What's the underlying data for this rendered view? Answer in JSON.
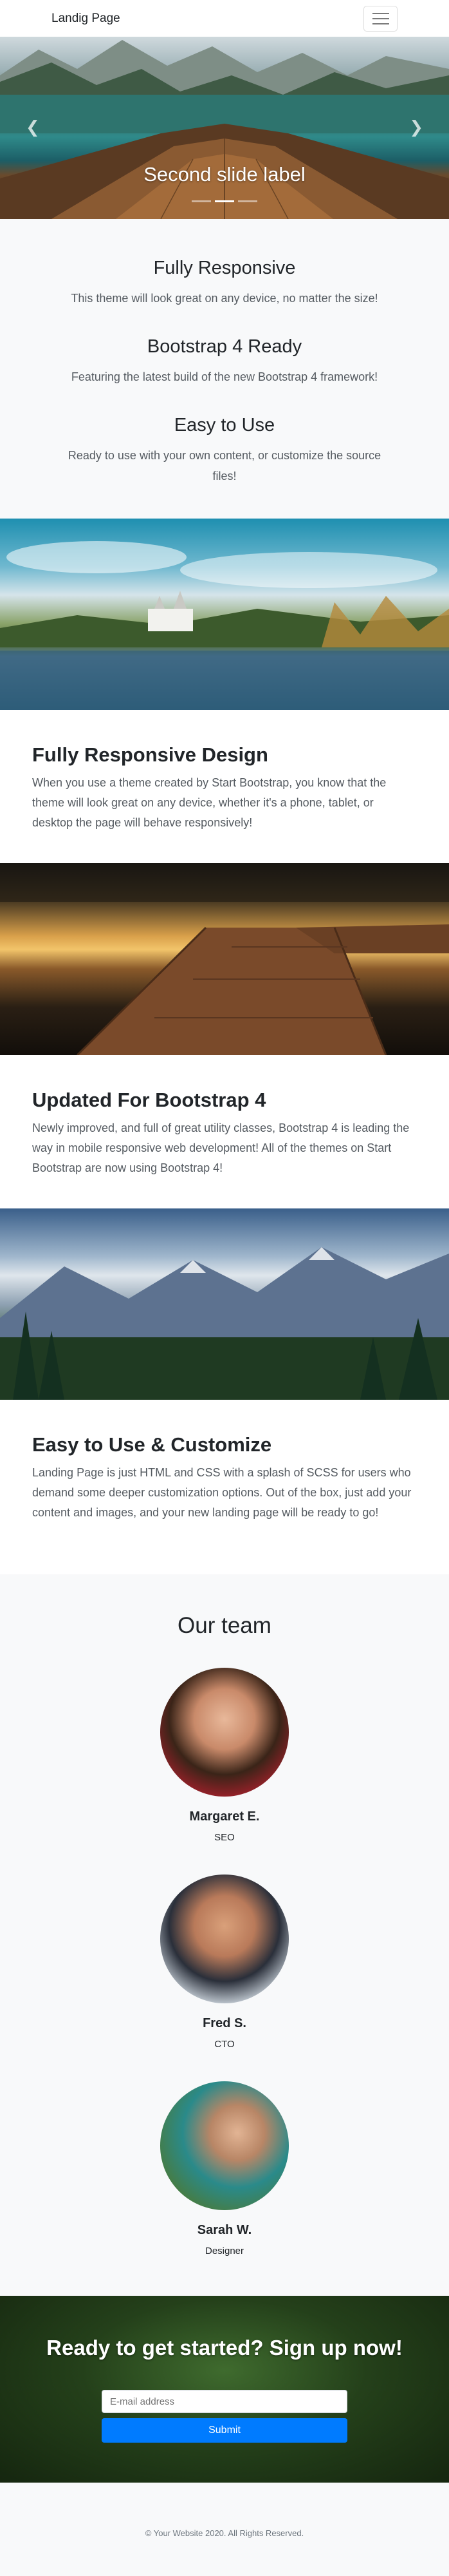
{
  "navbar": {
    "brand": "Landig Page",
    "toggle_icon": "hamburger-icon"
  },
  "carousel": {
    "caption": "Second slide label",
    "prev_icon": "chevron-left-icon",
    "next_icon": "chevron-right-icon",
    "slide_count": 3,
    "active_slide": 2
  },
  "features": [
    {
      "title": "Fully Responsive",
      "text": "This theme will look great on any device, no matter the size!"
    },
    {
      "title": "Bootstrap 4 Ready",
      "text": "Featuring the latest build of the new Bootstrap 4 framework!"
    },
    {
      "title": "Easy to Use",
      "text": "Ready to use with your own content, or customize the source files!"
    }
  ],
  "sections": [
    {
      "title": "Fully Responsive Design",
      "text": "When you use a theme created by Start Bootstrap, you know that the theme will look great on any device, whether it's a phone, tablet, or desktop the page will behave responsively!"
    },
    {
      "title": "Updated For Bootstrap 4",
      "text": "Newly improved, and full of great utility classes, Bootstrap 4 is leading the way in mobile responsive web development! All of the themes on Start Bootstrap are now using Bootstrap 4!"
    },
    {
      "title": "Easy to Use & Customize",
      "text": "Landing Page is just HTML and CSS with a splash of SCSS for users who demand some deeper customization options. Out of the box, just add your content and images, and your new landing page will be ready to go!"
    }
  ],
  "team": {
    "title": "Our team",
    "members": [
      {
        "name": "Margaret E.",
        "role": "SEO"
      },
      {
        "name": "Fred S.",
        "role": "CTO"
      },
      {
        "name": "Sarah W.",
        "role": "Designer"
      }
    ]
  },
  "signup": {
    "title": "Ready to get started? Sign up now!",
    "email_placeholder": "E-mail address",
    "submit_label": "Submit"
  },
  "footer": {
    "copyright": "© Your Website 2020. All Rights Reserved."
  },
  "colors": {
    "primary": "#007bff",
    "light_bg": "#f8f9fa",
    "text": "#212529",
    "muted": "#6c757d"
  }
}
